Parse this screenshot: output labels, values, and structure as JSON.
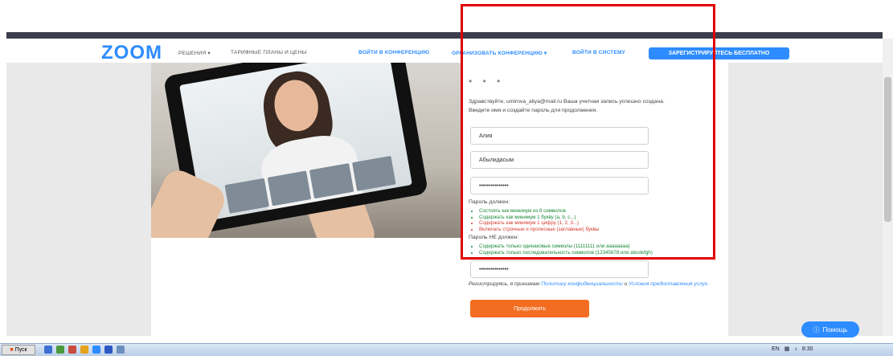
{
  "header": {
    "logo": "ZOOM",
    "nav": [
      "РЕШЕНИЯ ▾",
      "ТАРИФНЫЕ ПЛАНЫ И ЦЕНЫ"
    ],
    "join": "ВОЙТИ В КОНФЕРЕНЦИЮ",
    "host": "ОРГАНИЗОВАТЬ КОНФЕРЕНЦИЮ ▾",
    "signin": "ВОЙТИ В СИСТЕМУ",
    "signup": "ЗАРЕГИСТРИРУЙТЕСЬ БЕСПЛАТНО"
  },
  "form": {
    "dots": "• • •",
    "message_line1": "Здравствуйте, umirova_aliya@mail.ru Ваша учетная запись успешно создана.",
    "message_line2": "Введите имя и создайте пароль для продолжения.",
    "first_name": "Алия",
    "last_name": "Абылидасым",
    "password": "•••••••••••••••",
    "rules_must_title": "Пароль должен:",
    "rules_must": [
      {
        "text": "Состоять как минимум из 8 символов",
        "ok": true
      },
      {
        "text": "Содержать как минимум 1 букву (a, b, c...)",
        "ok": true
      },
      {
        "text": "Содержать как минимум 1 цифру (1, 2, 3...)",
        "ok": false
      },
      {
        "text": "Включать строчные и прописные (заглавные) буквы",
        "ok": false
      }
    ],
    "rules_mustnot_title": "Пароль НЕ должен:",
    "rules_mustnot": [
      {
        "text": "Содержать только одинаковые символы (11111111 или aaaaaaaa)",
        "ok": true
      },
      {
        "text": "Содержать только последовательность символов (12345678 или abcdefgh)",
        "ok": true
      }
    ],
    "confirm_password": "•••••••••••••••",
    "terms_prefix": "Регистрируясь, я принимаю",
    "terms_privacy": "Политику конфиденциальности",
    "terms_and": "и",
    "terms_service": "Условия предоставления услуг.",
    "continue": "Продолжить"
  },
  "help": {
    "icon": "question-icon",
    "label": "Помощь"
  },
  "taskbar": {
    "start": "Пуск",
    "lang": "EN",
    "clock": "8:30"
  },
  "colors": {
    "brand": "#2d8cff",
    "accent": "#f26d21",
    "highlight": "#e00000",
    "ok": "#1b8a3a",
    "bad": "#d63b32"
  }
}
